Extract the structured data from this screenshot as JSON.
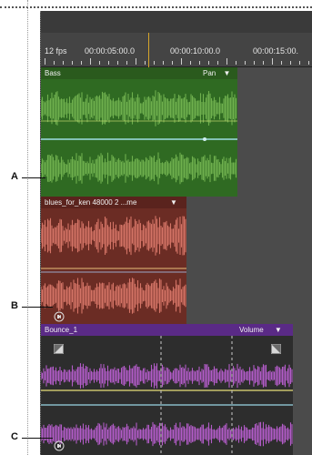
{
  "ruler": {
    "fps": "12 fps",
    "times": [
      "00:00:05:00.0",
      "00:00:10:00.0",
      "00:00:15:00."
    ]
  },
  "tracks": [
    {
      "id": "A",
      "name": "Bass",
      "menu_label": "Pan",
      "menu_arrow": "▼",
      "color_clip": "#2f6a22",
      "color_header": "#2a5a1d",
      "color_wave": "#6fb04e"
    },
    {
      "id": "B",
      "name": "blues_for_ken 48000 2 ...me",
      "menu_label": "",
      "menu_arrow": "▼",
      "color_clip": "#6b2c24",
      "color_header": "#5a231d",
      "color_wave": "#d47466"
    },
    {
      "id": "C",
      "name": "Bounce_1",
      "menu_label": "Volume",
      "menu_arrow": "▼",
      "color_clip": "#2d2d2d",
      "color_header": "#5a2a86",
      "color_wave": "#b35cc8"
    }
  ],
  "callouts": [
    "A",
    "B",
    "C"
  ],
  "icons": {
    "keyframe_left": "keyframe-left-icon",
    "keyframe_right": "keyframe-right-icon",
    "mute_badge": "audio-mute-icon"
  }
}
